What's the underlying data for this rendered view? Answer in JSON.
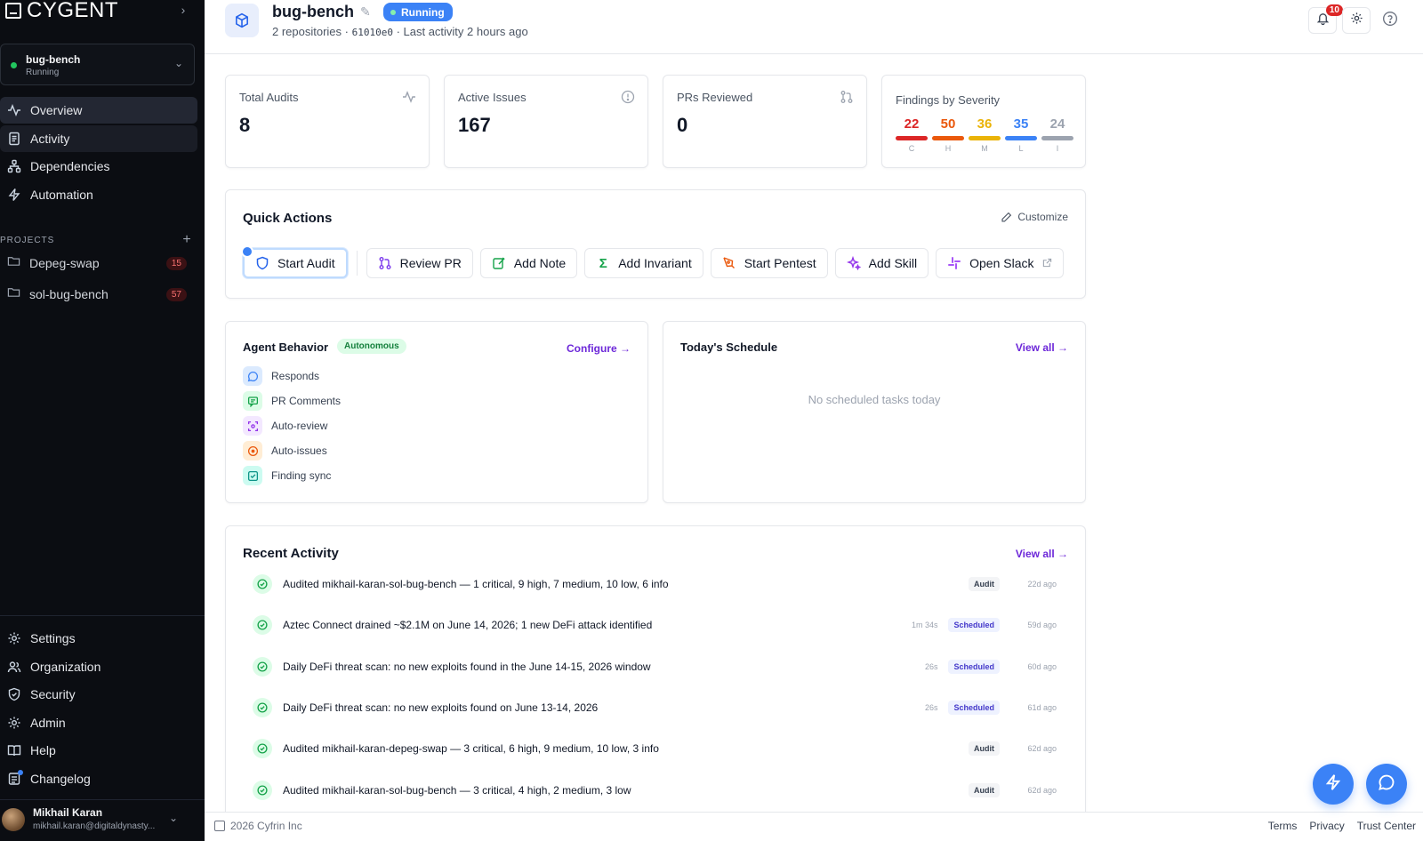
{
  "brand": {
    "name": "CYGENT"
  },
  "workspace": {
    "name": "bug-bench",
    "status": "Running"
  },
  "nav": [
    {
      "label": "Overview",
      "icon": "activity-pulse-icon"
    },
    {
      "label": "Activity",
      "icon": "document-icon"
    },
    {
      "label": "Dependencies",
      "icon": "dependency-graph-icon"
    },
    {
      "label": "Automation",
      "icon": "bolt-icon"
    }
  ],
  "projects": {
    "header": "PROJECTS",
    "items": [
      {
        "label": "Depeg-swap",
        "count": "15"
      },
      {
        "label": "sol-bug-bench",
        "count": "57"
      }
    ]
  },
  "bottom_nav": [
    {
      "label": "Settings",
      "icon": "gear-icon"
    },
    {
      "label": "Organization",
      "icon": "users-icon"
    },
    {
      "label": "Security",
      "icon": "shield-icon"
    },
    {
      "label": "Admin",
      "icon": "gear-icon"
    },
    {
      "label": "Help",
      "icon": "book-icon"
    },
    {
      "label": "Changelog",
      "icon": "changelog-icon"
    }
  ],
  "user": {
    "name": "Mikhail Karan",
    "email": "mikhail.karan@digitaldynasty..."
  },
  "header": {
    "title": "bug-bench",
    "status": "Running",
    "sub_prefix": "2 repositories · ",
    "commit": "61010e0",
    "sub_suffix": " · Last activity 2 hours ago",
    "notifications": "10"
  },
  "stats": {
    "total_audits": {
      "label": "Total Audits",
      "value": "8"
    },
    "active_issues": {
      "label": "Active Issues",
      "value": "167"
    },
    "prs_reviewed": {
      "label": "PRs Reviewed",
      "value": "0"
    }
  },
  "severity": {
    "title": "Findings by Severity",
    "items": [
      {
        "value": "22",
        "abbr": "C",
        "color": "#dc2626"
      },
      {
        "value": "50",
        "abbr": "H",
        "color": "#ea580c"
      },
      {
        "value": "36",
        "abbr": "M",
        "color": "#eab308"
      },
      {
        "value": "35",
        "abbr": "L",
        "color": "#3b82f6"
      },
      {
        "value": "24",
        "abbr": "I",
        "color": "#9ca3af"
      }
    ]
  },
  "quick_actions": {
    "title": "Quick Actions",
    "customize": "Customize",
    "items": [
      {
        "label": "Start Audit",
        "icon": "shield-icon"
      },
      {
        "label": "Review PR",
        "icon": "git-pull-request-icon"
      },
      {
        "label": "Add Note",
        "icon": "edit-note-icon"
      },
      {
        "label": "Add Invariant",
        "icon": "sigma-icon"
      },
      {
        "label": "Start Pentest",
        "icon": "pen-tool-icon"
      },
      {
        "label": "Add Skill",
        "icon": "sparkles-icon"
      },
      {
        "label": "Open Slack",
        "icon": "slack-icon"
      }
    ]
  },
  "agent_behavior": {
    "title": "Agent Behavior",
    "mode": "Autonomous",
    "configure": "Configure →",
    "items": [
      {
        "label": "Responds",
        "icon": "chat-bubble-icon",
        "color": "#3b82f6",
        "bg": "#dbeafe"
      },
      {
        "label": "PR Comments",
        "icon": "comment-icon",
        "color": "#16a34a",
        "bg": "#dcfce7"
      },
      {
        "label": "Auto-review",
        "icon": "scan-icon",
        "color": "#9333ea",
        "bg": "#f3e8ff"
      },
      {
        "label": "Auto-issues",
        "icon": "target-icon",
        "color": "#ea580c",
        "bg": "#ffedd5"
      },
      {
        "label": "Finding sync",
        "icon": "check-square-icon",
        "color": "#0d9488",
        "bg": "#ccfbf1"
      }
    ]
  },
  "schedule": {
    "title": "Today's Schedule",
    "view_all": "View all →",
    "empty": "No scheduled tasks today"
  },
  "recent_activity": {
    "title": "Recent Activity",
    "view_all": "View all →",
    "items": [
      {
        "text": "Audited mikhail-karan-sol-bug-bench — 1 critical, 9 high, 7 medium, 10 low, 6 info",
        "duration": "",
        "tag": "Audit",
        "ago": "22d ago"
      },
      {
        "text": "Aztec Connect drained ~$2.1M on June 14, 2026; 1 new DeFi attack identified",
        "duration": "1m 34s",
        "tag": "Scheduled",
        "ago": "59d ago"
      },
      {
        "text": "Daily DeFi threat scan: no new exploits found in the June 14-15, 2026 window",
        "duration": "26s",
        "tag": "Scheduled",
        "ago": "60d ago"
      },
      {
        "text": "Daily DeFi threat scan: no new exploits found on June 13-14, 2026",
        "duration": "26s",
        "tag": "Scheduled",
        "ago": "61d ago"
      },
      {
        "text": "Audited mikhail-karan-depeg-swap — 3 critical, 6 high, 9 medium, 10 low, 3 info",
        "duration": "",
        "tag": "Audit",
        "ago": "62d ago"
      },
      {
        "text": "Audited mikhail-karan-sol-bug-bench — 3 critical, 4 high, 2 medium, 3 low",
        "duration": "",
        "tag": "Audit",
        "ago": "62d ago"
      }
    ]
  },
  "footer": {
    "copyright": "2026 Cyfrin Inc",
    "links": [
      "Terms",
      "Privacy",
      "Trust Center"
    ]
  },
  "colors": {
    "accent": "#3b82f6",
    "link": "#6d28d9",
    "sidebar_bg": "#0b0d12"
  }
}
